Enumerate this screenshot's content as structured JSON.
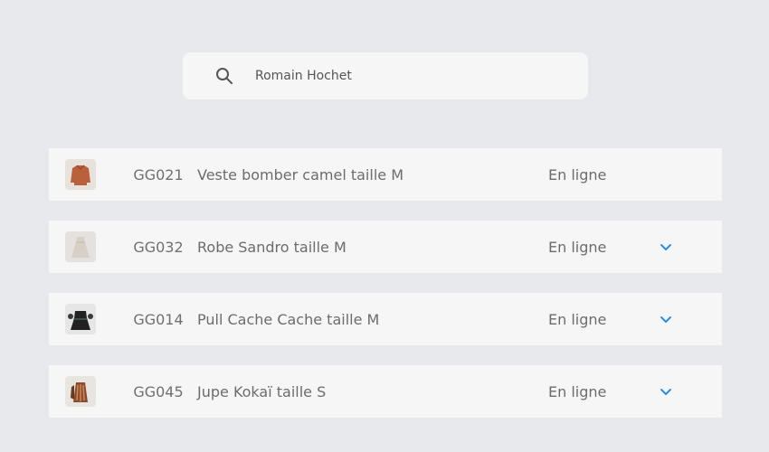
{
  "search": {
    "value": "Romain Hochet",
    "icon": "search-icon"
  },
  "rows": [
    {
      "code": "GG021",
      "name": "Veste bomber camel taille M",
      "status": "En ligne",
      "thumbnail": "jacket-thumbnail",
      "has_chevron": false
    },
    {
      "code": "GG032",
      "name": "Robe Sandro taille M",
      "status": "En ligne",
      "thumbnail": "dress-thumbnail",
      "has_chevron": true
    },
    {
      "code": "GG014",
      "name": "Pull Cache Cache taille M",
      "status": "En ligne",
      "thumbnail": "sweater-thumbnail",
      "has_chevron": true
    },
    {
      "code": "GG045",
      "name": "Jupe Kokaï taille S",
      "status": "En ligne",
      "thumbnail": "skirt-thumbnail",
      "has_chevron": true
    }
  ],
  "colors": {
    "background": "#e7e9ec",
    "card": "#f6f6f7",
    "chevron": "#2f8fd0",
    "text": "#6c6c6c"
  }
}
